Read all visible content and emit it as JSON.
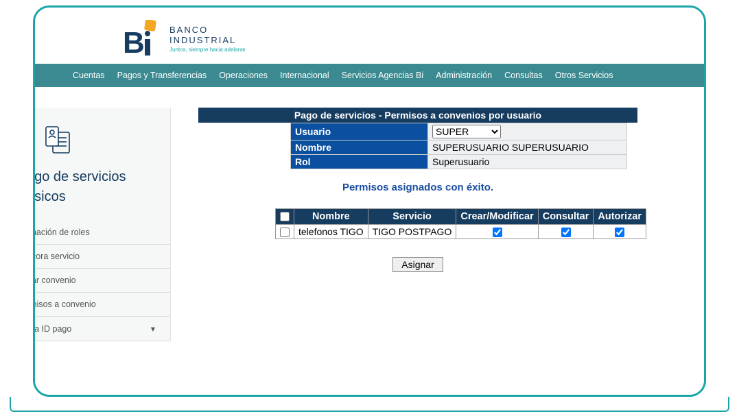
{
  "logo": {
    "brand1": "BANCO",
    "brand2": "INDUSTRIAL",
    "tagline": "Juntos, siempre hacia adelante"
  },
  "topnav": [
    "Cuentas",
    "Pagos y Transferencias",
    "Operaciones",
    "Internacional",
    "Servicios Agencias Bi",
    "Administración",
    "Consultas",
    "Otros Servicios"
  ],
  "sidebar": {
    "title1": "ago de servicios",
    "title2": "ásicos",
    "items": [
      "gnación de roles",
      "ácora servicio",
      "ear convenio",
      "rmisos a convenio",
      "rga ID pago"
    ]
  },
  "section_header": "Pago de servicios - Permisos a convenios por usuario",
  "info": {
    "usuario_label": "Usuario",
    "usuario_value": "SUPER",
    "nombre_label": "Nombre",
    "nombre_value": "SUPERUSUARIO SUPERUSUARIO",
    "rol_label": "Rol",
    "rol_value": "Superusuario"
  },
  "success_msg": "Permisos asignados con éxito.",
  "perm_table": {
    "headers": [
      "Nombre",
      "Servicio",
      "Crear/Modificar",
      "Consultar",
      "Autorizar"
    ],
    "row": {
      "nombre": "telefonos TIGO",
      "servicio": "TIGO POSTPAGO",
      "crear": true,
      "consultar": true,
      "autorizar": true
    }
  },
  "assign_btn": "Asignar"
}
